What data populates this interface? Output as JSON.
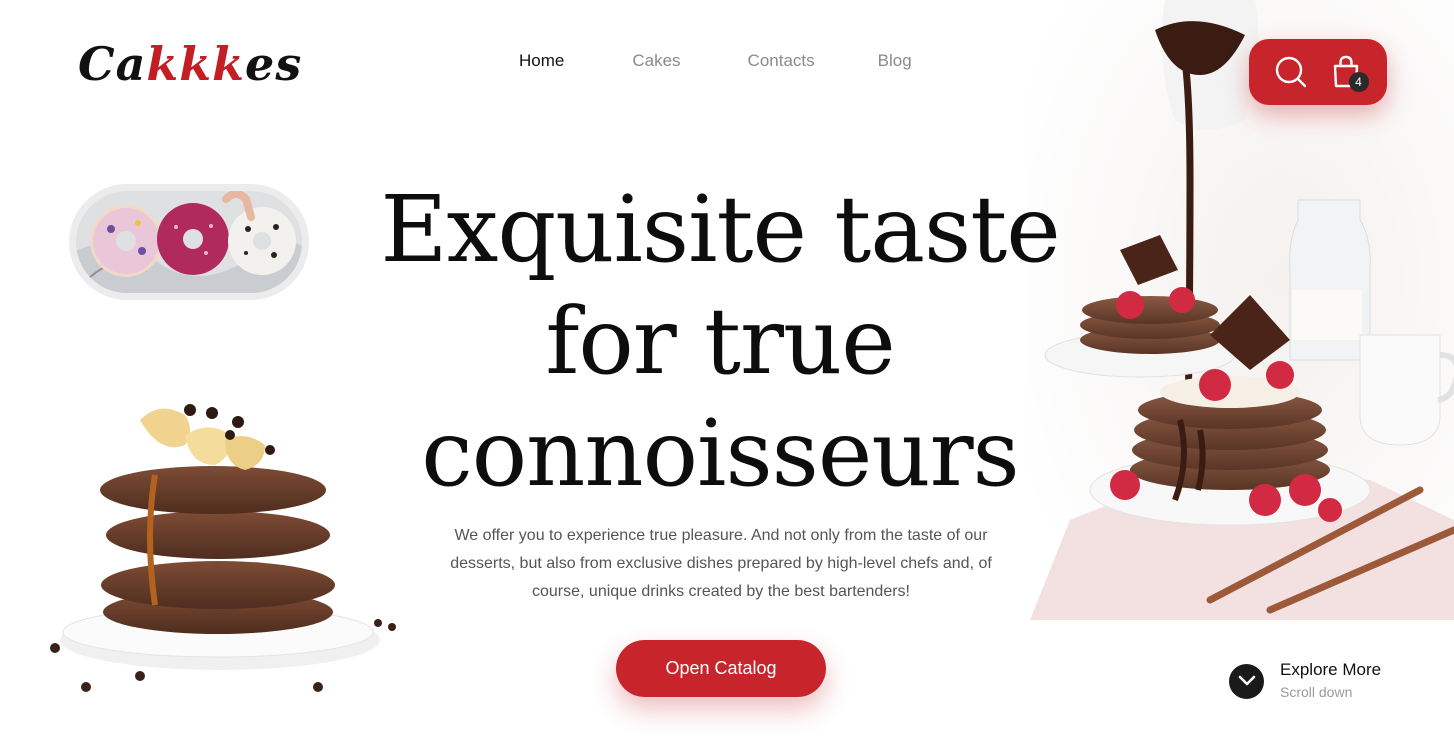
{
  "brand": {
    "logo_part1": "Ca",
    "logo_part2": "kkk",
    "logo_part3": "es",
    "accent_color": "#c8242b"
  },
  "nav": {
    "items": [
      {
        "label": "Home",
        "active": true
      },
      {
        "label": "Cakes",
        "active": false
      },
      {
        "label": "Contacts",
        "active": false
      },
      {
        "label": "Blog",
        "active": false
      }
    ]
  },
  "actions": {
    "search_icon": "search-icon",
    "cart_icon": "shopping-bag-icon",
    "cart_count": "4"
  },
  "hero": {
    "title_line1": "Exquisite taste",
    "title_line2": "for true",
    "title_line3": "connoisseurs",
    "description": "We offer you to experience true pleasure. And not only from the taste of our desserts, but also from exclusive dishes prepared by high-level chefs and, of course, unique drinks created by the best bartenders!",
    "cta_label": "Open Catalog"
  },
  "explore": {
    "title": "Explore More",
    "subtitle": "Scroll down",
    "icon": "chevron-down-icon"
  }
}
